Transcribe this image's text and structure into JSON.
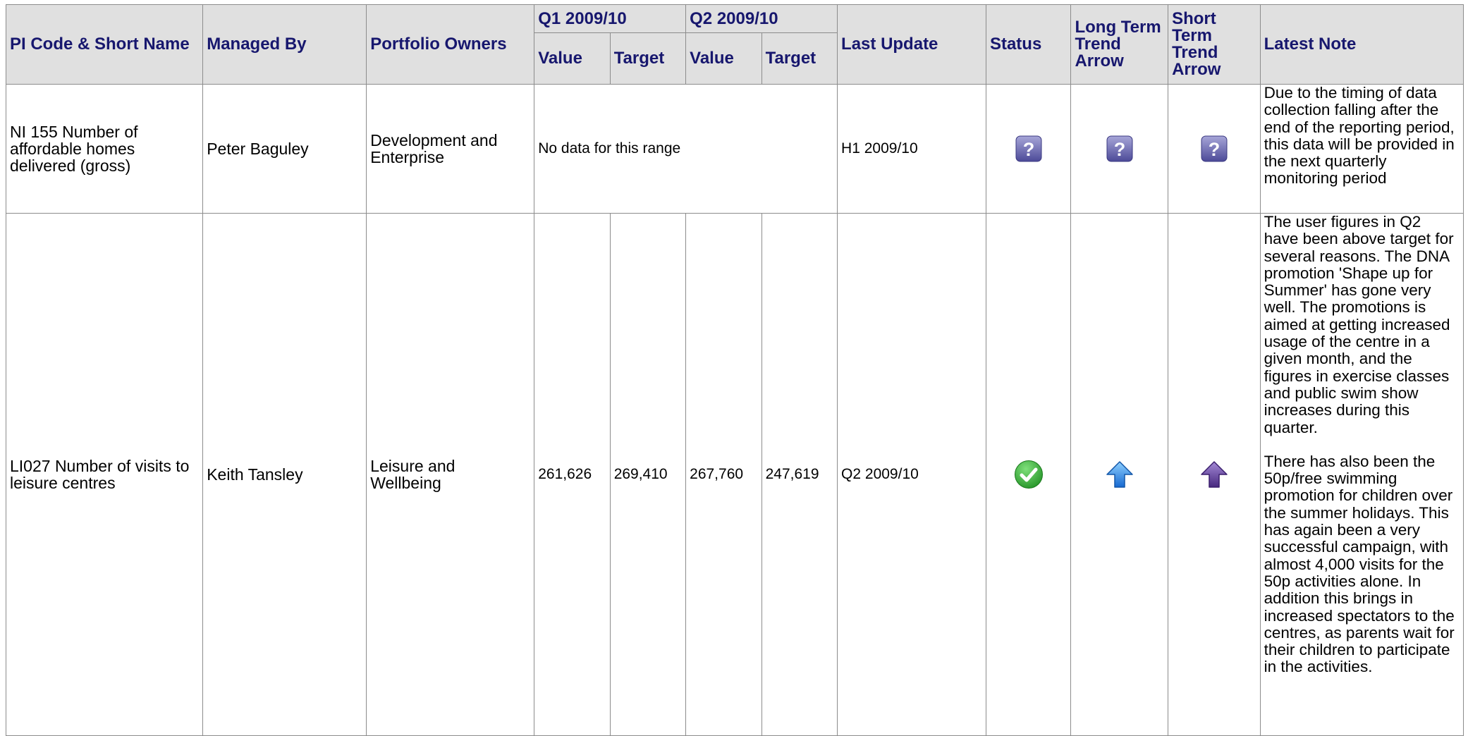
{
  "header": {
    "pi_code": "PI Code & Short Name",
    "managed_by": "Managed By",
    "portfolio_owners": "Portfolio Owners",
    "q1": "Q1 2009/10",
    "q2": "Q2 2009/10",
    "value": "Value",
    "target": "Target",
    "last_update": "Last Update",
    "status": "Status",
    "long_term_trend": "Long Term Trend Arrow",
    "short_term_trend": "Short Term Trend Arrow",
    "latest_note": "Latest Note"
  },
  "rows": [
    {
      "pi": "NI 155 Number of affordable homes delivered (gross)",
      "managed_by": "Peter Baguley",
      "portfolio": "Development and Enterprise",
      "no_data": "No data for this range",
      "last_update": "H1 2009/10",
      "status_icon": "unknown-icon",
      "long_term_icon": "unknown-icon",
      "short_term_icon": "unknown-icon",
      "note": "Due to the timing of data  collection falling after the end of the reporting period, this data will be provided in the next quarterly monitoring period"
    },
    {
      "pi": "LI027 Number of visits to leisure centres",
      "managed_by": "Keith Tansley",
      "portfolio": "Leisure and Wellbeing",
      "q1_value": "261,626",
      "q1_target": "269,410",
      "q2_value": "267,760",
      "q2_target": "247,619",
      "last_update": "Q2 2009/10",
      "status_icon": "green-check-icon",
      "long_term_icon": "blue-up-arrow-icon",
      "short_term_icon": "purple-up-arrow-icon",
      "note_p1": "The user figures in Q2 have been above target for several reasons. The  DNA promotion 'Shape up for Summer' has gone very well. The promotions is aimed at getting increased usage of the centre in a given month, and the figures in  exercise classes and public swim show increases during this quarter.",
      "note_p2": "There has also been the  50p/free swimming promotion for children over the summer holidays. This has again been a very successful campaign, with almost 4,000 visits for the 50p activities alone. In addition this brings in increased spectators to the centres, as parents wait for their children to participate in the activities."
    }
  ],
  "colors": {
    "header_bg": "#e0e0e0",
    "header_text": "#17176e",
    "border": "#8c8c8c"
  }
}
